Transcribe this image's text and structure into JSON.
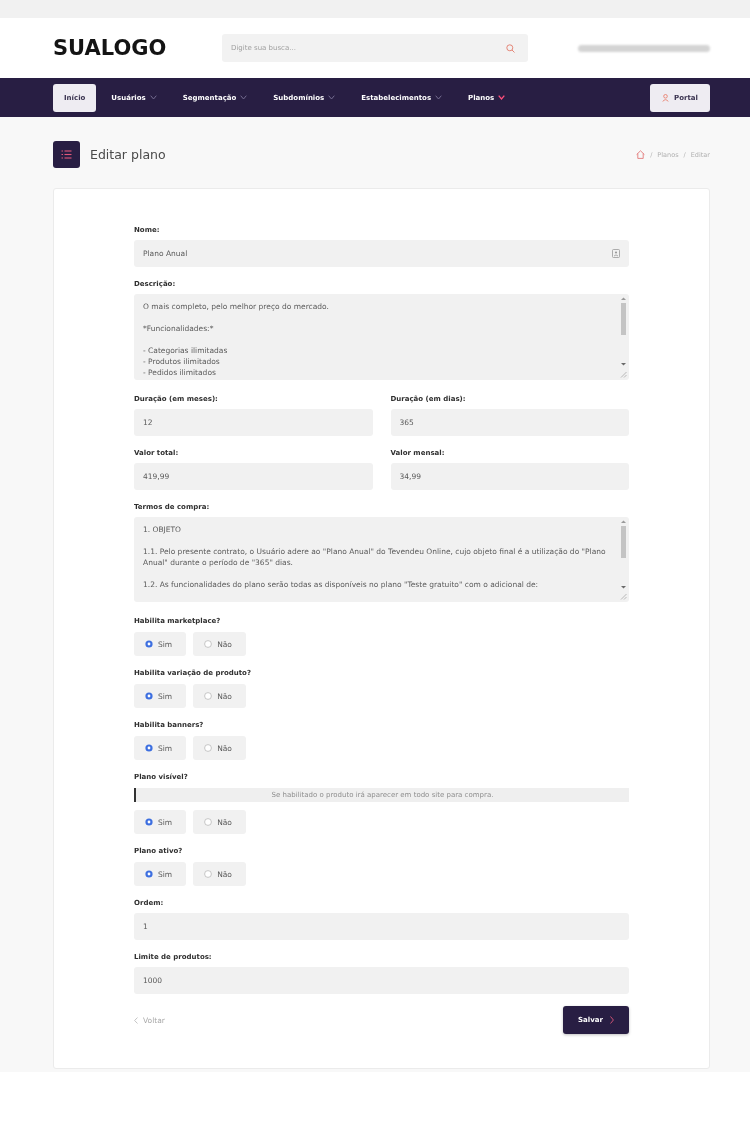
{
  "header": {
    "logo": "SUALOGO",
    "search": {
      "placeholder": "Digite sua busca..."
    }
  },
  "nav": {
    "items": [
      {
        "label": "Início",
        "selected": true,
        "dropdown": false
      },
      {
        "label": "Usuários",
        "selected": false,
        "dropdown": true,
        "current": false
      },
      {
        "label": "Segmentação",
        "selected": false,
        "dropdown": true,
        "current": false
      },
      {
        "label": "Subdomínios",
        "selected": false,
        "dropdown": true,
        "current": false
      },
      {
        "label": "Estabelecimentos",
        "selected": false,
        "dropdown": true,
        "current": false
      },
      {
        "label": "Planos",
        "selected": false,
        "dropdown": true,
        "current": true
      }
    ],
    "portal_button": "Portal"
  },
  "page": {
    "title": "Editar plano",
    "breadcrumb": [
      {
        "kind": "home"
      },
      {
        "kind": "separator",
        "text": "/"
      },
      {
        "kind": "link",
        "text": "Planos"
      },
      {
        "kind": "separator",
        "text": "/"
      },
      {
        "kind": "current",
        "text": "Editar"
      }
    ]
  },
  "form": {
    "rows": [
      {
        "kind": "input",
        "label": "Nome:",
        "value": "Plano Anual",
        "has_icon": true
      },
      {
        "kind": "textarea",
        "label": "Descrição:",
        "value": "O mais completo, pelo melhor preço do mercado.\n\n*Funcionalidades:*\n\n- Categorias ilimitadas\n- Produtos ilimitados\n- Pedidos ilimitados"
      },
      {
        "kind": "pair",
        "fields": [
          {
            "label": "Duração (em meses):",
            "value": "12"
          },
          {
            "label": "Duração (em dias):",
            "value": "365"
          }
        ]
      },
      {
        "kind": "pair",
        "fields": [
          {
            "label": "Valor total:",
            "value": "419,99"
          },
          {
            "label": "Valor mensal:",
            "value": "34,99"
          }
        ]
      },
      {
        "kind": "textarea",
        "label": "Termos de compra:",
        "value": "1. OBJETO\n\n1.1. Pelo presente contrato, o Usuário adere ao \"Plano Anual\" do Tevendeu Online, cujo objeto final é a utilização do \"Plano Anual\" durante o período de \"365\" dias.\n\n1.2. As funcionalidades do plano serão todas as disponíveis no plano \"Teste gratuito\" com o adicional de:"
      },
      {
        "kind": "radio",
        "label": "Habilita marketplace?",
        "options": [
          {
            "label": "Sim",
            "selected": true
          },
          {
            "label": "Não",
            "selected": false
          }
        ]
      },
      {
        "kind": "radio",
        "label": "Habilita variação de produto?",
        "options": [
          {
            "label": "Sim",
            "selected": true
          },
          {
            "label": "Não",
            "selected": false
          }
        ]
      },
      {
        "kind": "radio",
        "label": "Habilita banners?",
        "options": [
          {
            "label": "Sim",
            "selected": true
          },
          {
            "label": "Não",
            "selected": false
          }
        ]
      },
      {
        "kind": "radio",
        "label": "Plano visível?",
        "hint": "Se habilitado o produto irá aparecer em todo site para compra.",
        "options": [
          {
            "label": "Sim",
            "selected": true
          },
          {
            "label": "Não",
            "selected": false
          }
        ]
      },
      {
        "kind": "radio",
        "label": "Plano ativo?",
        "options": [
          {
            "label": "Sim",
            "selected": true
          },
          {
            "label": "Não",
            "selected": false
          }
        ]
      },
      {
        "kind": "input",
        "label": "Ordem:",
        "value": "1"
      },
      {
        "kind": "input",
        "label": "Limite de produtos:",
        "value": "1000"
      }
    ],
    "back_link": "Voltar",
    "submit_button": "Salvar"
  }
}
